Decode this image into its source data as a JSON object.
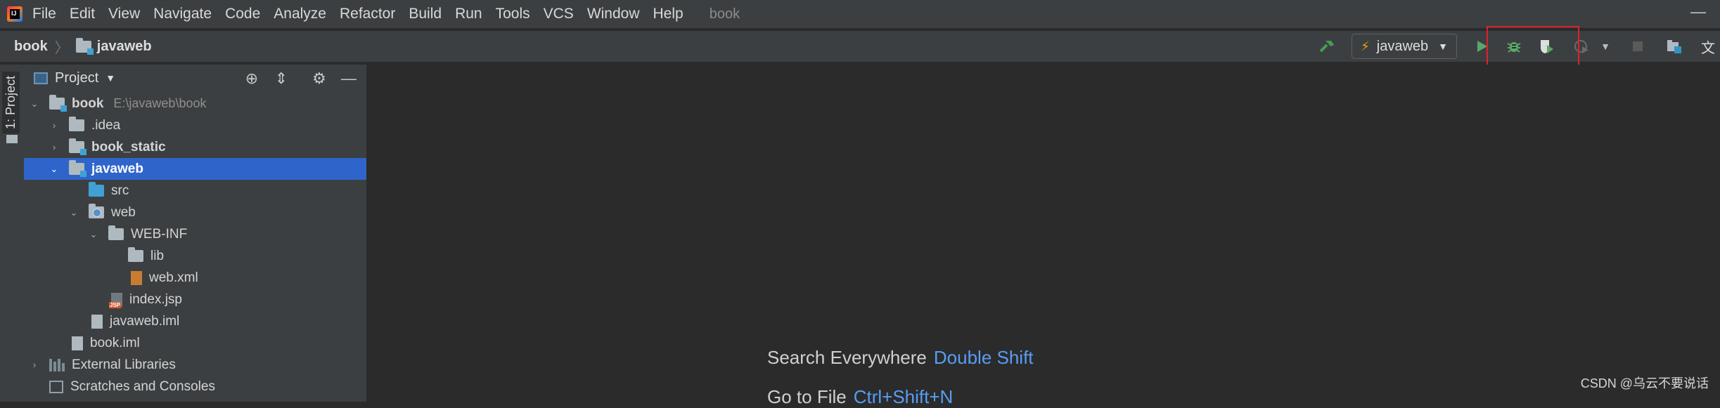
{
  "menubar": {
    "logo_text": "IJ",
    "items": [
      "File",
      "Edit",
      "View",
      "Navigate",
      "Code",
      "Analyze",
      "Refactor",
      "Build",
      "Run",
      "Tools",
      "VCS",
      "Window",
      "Help"
    ],
    "project_name": "book",
    "minimize": "—"
  },
  "breadcrumb": {
    "root": "book",
    "separator": "〉",
    "module": "javaweb"
  },
  "toolbar": {
    "run_config": "javaweb",
    "icons": [
      "build-hammer-icon",
      "run-icon",
      "debug-icon",
      "coverage-icon",
      "profiler-icon",
      "stop-icon",
      "project-structure-icon",
      "translate-icon"
    ]
  },
  "colors": {
    "run": "#59a869",
    "build": "#499c54",
    "selection": "#2f65ca",
    "highlight": "#e0202a",
    "link": "#589df6"
  },
  "sidebar": {
    "tab_label": "1: Project"
  },
  "project_panel": {
    "title": "Project",
    "tree": [
      {
        "label": "book",
        "path": "E:\\javaweb\\book",
        "bold": true
      },
      {
        "label": ".idea"
      },
      {
        "label": "book_static",
        "bold": true
      },
      {
        "label": "javaweb",
        "bold": true,
        "selected": true
      },
      {
        "label": "src"
      },
      {
        "label": "web"
      },
      {
        "label": "WEB-INF"
      },
      {
        "label": "lib"
      },
      {
        "label": "web.xml"
      },
      {
        "label": "index.jsp"
      },
      {
        "label": "javaweb.iml"
      },
      {
        "label": "book.iml"
      },
      {
        "label": "External Libraries"
      },
      {
        "label": "Scratches and Consoles"
      }
    ]
  },
  "editor": {
    "hints": [
      {
        "label": "Search Everywhere",
        "key": "Double Shift"
      },
      {
        "label": "Go to File",
        "key": "Ctrl+Shift+N"
      }
    ]
  },
  "watermark": "CSDN @乌云不要说话"
}
